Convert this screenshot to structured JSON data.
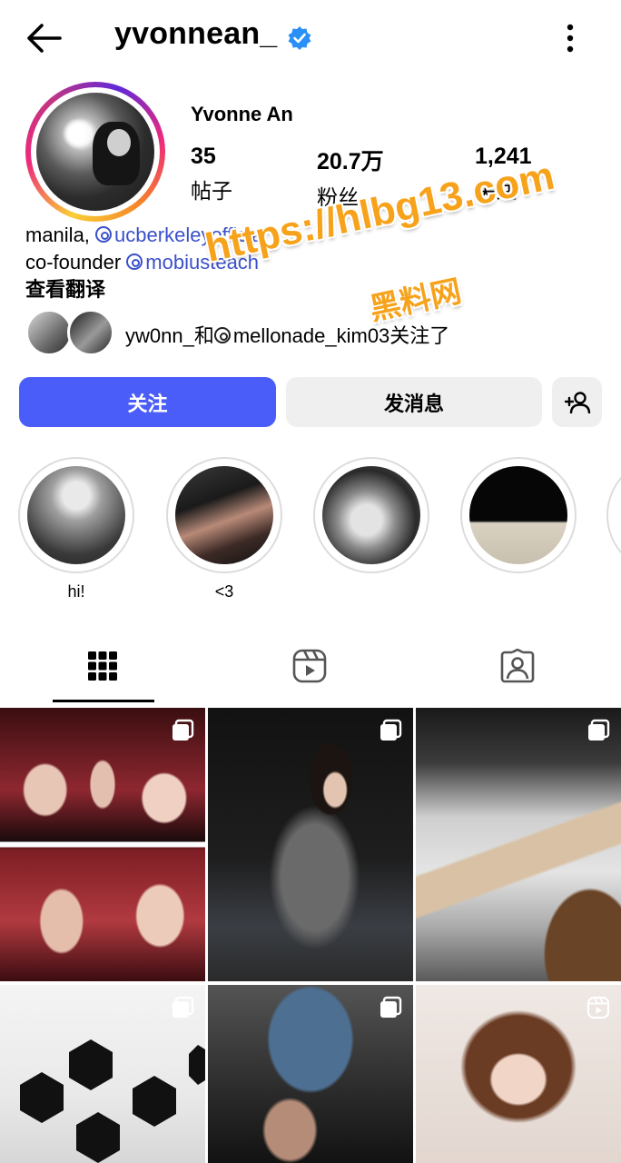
{
  "header": {
    "username": "yvonnean_",
    "back_icon": "back-arrow-icon",
    "verified_icon": "verified-badge-icon",
    "more_icon": "more-vertical-icon"
  },
  "profile": {
    "display_name": "Yvonne An",
    "stats": [
      {
        "value": "35",
        "label": "帖子"
      },
      {
        "value": "20.7万",
        "label": "粉丝"
      },
      {
        "value": "1,241",
        "label": "关注"
      }
    ],
    "bio": {
      "line1_prefix": "manila, ",
      "line1_link": "ucberkeleyofficial",
      "line2_prefix": "co-founder ",
      "line2_link": "mobiusteach",
      "translate": "查看翻译"
    },
    "followed_by": {
      "user1": "yw0nn_",
      "joiner": "和",
      "user2": "mellonade_kim03",
      "suffix": "关注了"
    }
  },
  "watermark": {
    "url": "https://hlbg13.com",
    "name": "黑料网"
  },
  "actions": {
    "follow_label": "关注",
    "message_label": "发消息",
    "add_user_icon": "add-person-icon"
  },
  "highlights": [
    {
      "label": "hi!"
    },
    {
      "label": "<3"
    },
    {
      "label": ""
    },
    {
      "label": ""
    }
  ],
  "tabs": [
    {
      "name": "posts",
      "icon": "grid-icon",
      "selected": true
    },
    {
      "name": "reels",
      "icon": "reels-icon",
      "selected": false
    },
    {
      "name": "tagged",
      "icon": "tagged-person-icon",
      "selected": false
    }
  ],
  "colors": {
    "follow_button": "#4a5df9",
    "link": "#3b50c9",
    "secondary_button": "#efeff0",
    "verified": "#2a8ff7",
    "watermark": "#f7a21b"
  }
}
